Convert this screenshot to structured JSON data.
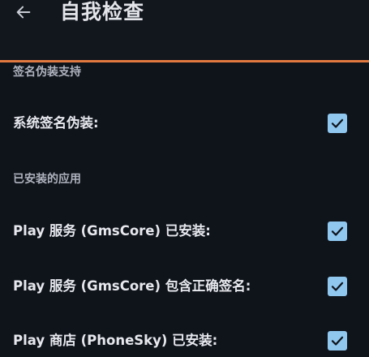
{
  "header": {
    "back_icon": "arrow-left-icon",
    "title": "自我检查"
  },
  "colors": {
    "background": "#0f131a",
    "accent_line": "#e27a3f",
    "checkbox_fill": "#8fc7ef",
    "checkmark": "#0f131a"
  },
  "sections": [
    {
      "header": "签名伪装支持",
      "items": [
        {
          "label": "系统签名伪装:",
          "checked": true
        }
      ]
    },
    {
      "header": "已安装的应用",
      "items": [
        {
          "label": "Play 服务 (GmsCore) 已安装:",
          "checked": true
        },
        {
          "label": "Play 服务 (GmsCore) 包含正确签名:",
          "checked": true
        },
        {
          "label": "Play 商店 (PhoneSky) 已安装:",
          "checked": true
        }
      ]
    }
  ]
}
